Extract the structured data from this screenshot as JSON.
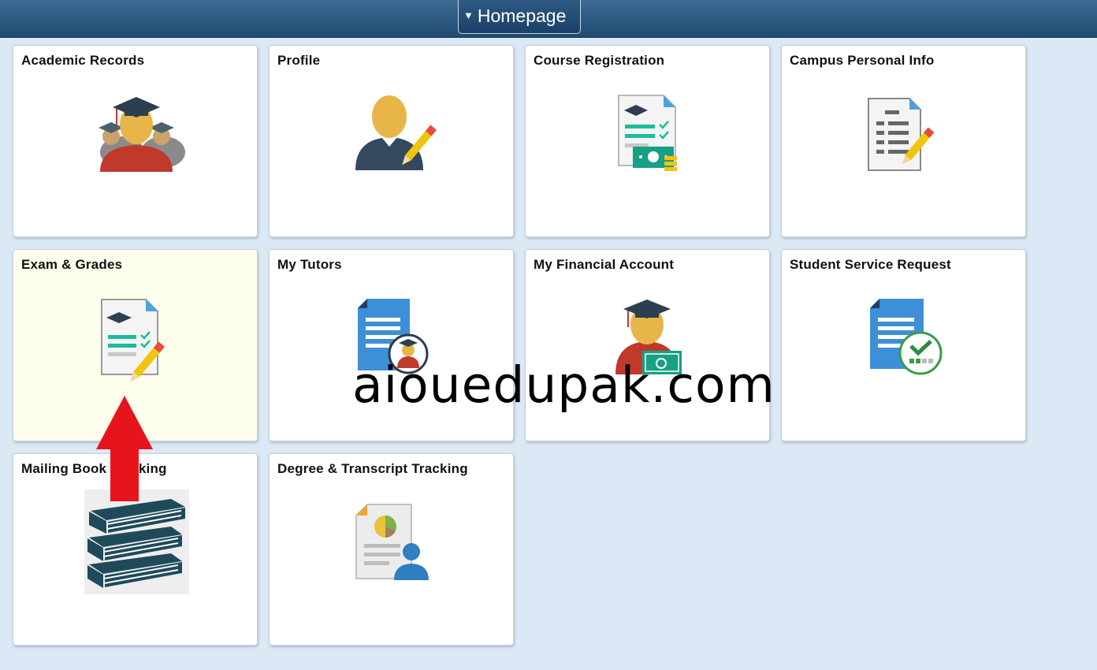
{
  "header": {
    "caret_icon": "caret-down-icon",
    "homepage_label": "Homepage"
  },
  "tiles": [
    {
      "label": "Academic Records",
      "icon": "graduates-group-icon"
    },
    {
      "label": "Profile",
      "icon": "profile-edit-icon"
    },
    {
      "label": "Course Registration",
      "icon": "course-registration-icon"
    },
    {
      "label": "Campus Personal Info",
      "icon": "personal-info-document-icon"
    },
    {
      "label": "Exam & Grades",
      "icon": "exam-grades-icon"
    },
    {
      "label": "My Tutors",
      "icon": "tutors-document-icon"
    },
    {
      "label": "My Financial Account",
      "icon": "financial-account-icon"
    },
    {
      "label": "Student Service Request",
      "icon": "service-request-icon"
    },
    {
      "label": "Mailing Book Tracking",
      "icon": "books-stack-icon"
    },
    {
      "label": "Degree & Transcript Tracking",
      "icon": "transcript-tracking-icon"
    }
  ],
  "highlighted_tile": "Exam & Grades",
  "overlay": {
    "watermark": "aiouedupak.com",
    "arrow_color": "#e8141c",
    "arrow_icon": "up-arrow-icon"
  },
  "colors": {
    "background": "#dbe8f5",
    "header": "#2a5680",
    "tile_highlight": "#fdffec"
  }
}
